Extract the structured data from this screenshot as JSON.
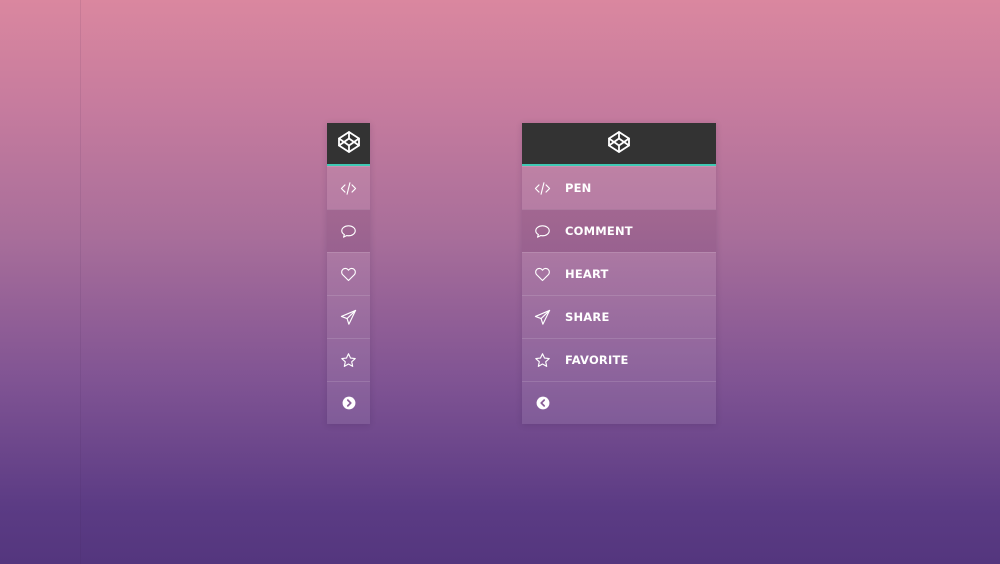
{
  "app": {
    "logo_icon": "codepen-logo-icon",
    "accent_color": "#3fc9b4",
    "header_color": "#333333"
  },
  "collapsed_menu": {
    "items": [
      {
        "icon": "code-icon"
      },
      {
        "icon": "comment-icon",
        "active": true
      },
      {
        "icon": "heart-icon"
      },
      {
        "icon": "share-icon"
      },
      {
        "icon": "star-icon"
      },
      {
        "icon": "chevron-right-circle-icon"
      }
    ]
  },
  "expanded_menu": {
    "items": [
      {
        "icon": "code-icon",
        "label": "PEN"
      },
      {
        "icon": "comment-icon",
        "label": "COMMENT",
        "active": true
      },
      {
        "icon": "heart-icon",
        "label": "HEART"
      },
      {
        "icon": "share-icon",
        "label": "SHARE"
      },
      {
        "icon": "star-icon",
        "label": "FAVORITE"
      },
      {
        "icon": "chevron-left-circle-icon"
      }
    ]
  }
}
